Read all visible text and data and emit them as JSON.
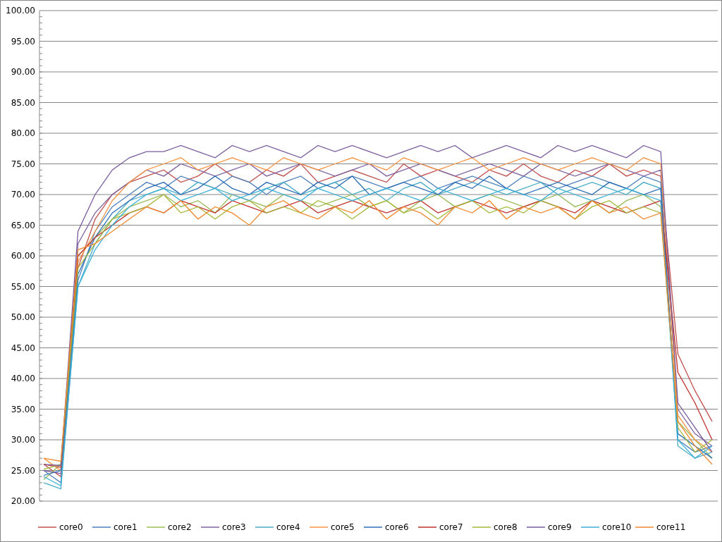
{
  "chart_data": {
    "type": "line",
    "ylim": [
      20,
      100
    ],
    "grid": true,
    "legend": true,
    "yticks": [
      {
        "value": 20,
        "label": "20.00"
      },
      {
        "value": 25,
        "label": "25.00"
      },
      {
        "value": 30,
        "label": "30.00"
      },
      {
        "value": 35,
        "label": "35.00"
      },
      {
        "value": 40,
        "label": "40.00"
      },
      {
        "value": 45,
        "label": "45.00"
      },
      {
        "value": 50,
        "label": "50.00"
      },
      {
        "value": 55,
        "label": "55.00"
      },
      {
        "value": 60,
        "label": "60.00"
      },
      {
        "value": 65,
        "label": "65.00"
      },
      {
        "value": 70,
        "label": "70.00"
      },
      {
        "value": 75,
        "label": "75.00"
      },
      {
        "value": 80,
        "label": "80.00"
      },
      {
        "value": 85,
        "label": "85.00"
      },
      {
        "value": 90,
        "label": "90.00"
      },
      {
        "value": 95,
        "label": "95.00"
      },
      {
        "value": 100,
        "label": "100.00"
      }
    ],
    "series": [
      {
        "name": "core0",
        "color": "#c0504d",
        "values": [
          26,
          24,
          58,
          66,
          70,
          72,
          73,
          74,
          72,
          73,
          75,
          73,
          72,
          74,
          73,
          75,
          72,
          73,
          74,
          73,
          72,
          75,
          73,
          74,
          73,
          72,
          74,
          73,
          75,
          73,
          72,
          74,
          73,
          75,
          73,
          74,
          73,
          44,
          38,
          33
        ]
      },
      {
        "name": "core1",
        "color": "#4f81bd",
        "values": [
          25,
          23,
          56,
          64,
          68,
          70,
          72,
          71,
          73,
          72,
          71,
          73,
          72,
          70,
          72,
          73,
          71,
          72,
          73,
          72,
          71,
          72,
          73,
          71,
          72,
          73,
          72,
          71,
          73,
          72,
          71,
          72,
          73,
          72,
          71,
          73,
          72,
          30,
          28,
          29
        ]
      },
      {
        "name": "core2",
        "color": "#9bbb59",
        "values": [
          23.5,
          26,
          60,
          63,
          66,
          68,
          69,
          70,
          68,
          69,
          67,
          70,
          69,
          68,
          70,
          69,
          68,
          69,
          70,
          68,
          69,
          67,
          69,
          70,
          68,
          69,
          70,
          69,
          68,
          69,
          70,
          68,
          69,
          67,
          69,
          70,
          68,
          33,
          30,
          27
        ]
      },
      {
        "name": "core3",
        "color": "#8064a2",
        "values": [
          25,
          24.5,
          62,
          67,
          70,
          72,
          74,
          73,
          75,
          74,
          73,
          74,
          75,
          73,
          74,
          75,
          74,
          73,
          74,
          75,
          73,
          74,
          75,
          74,
          73,
          74,
          75,
          74,
          73,
          75,
          74,
          73,
          74,
          75,
          74,
          73,
          74,
          35,
          31,
          29
        ]
      },
      {
        "name": "core4",
        "color": "#4bacc6",
        "values": [
          23,
          22,
          55,
          62,
          66,
          69,
          70,
          71,
          70,
          72,
          71,
          70,
          69,
          71,
          72,
          70,
          71,
          72,
          70,
          71,
          69,
          71,
          72,
          70,
          71,
          72,
          71,
          70,
          71,
          72,
          70,
          71,
          72,
          71,
          70,
          72,
          71,
          29,
          27,
          28
        ]
      },
      {
        "name": "core5",
        "color": "#f79646",
        "values": [
          27,
          25,
          59,
          64,
          69,
          72,
          74,
          75,
          76,
          74,
          75,
          76,
          75,
          74,
          76,
          75,
          74,
          75,
          76,
          75,
          74,
          76,
          75,
          74,
          75,
          76,
          74,
          75,
          76,
          75,
          74,
          75,
          76,
          75,
          74,
          76,
          75,
          34,
          30,
          28
        ]
      },
      {
        "name": "core6",
        "color": "#2c6fb5",
        "values": [
          24.2,
          25,
          57,
          63,
          67,
          69,
          71,
          72,
          70,
          71,
          73,
          71,
          70,
          72,
          71,
          70,
          72,
          71,
          73,
          70,
          71,
          72,
          71,
          70,
          72,
          71,
          73,
          71,
          70,
          71,
          72,
          71,
          70,
          72,
          71,
          70,
          71,
          31,
          29,
          27
        ]
      },
      {
        "name": "core7",
        "color": "#c0302c",
        "values": [
          26,
          25.5,
          60,
          63,
          65,
          67,
          68,
          67,
          69,
          68,
          67,
          69,
          68,
          67,
          68,
          69,
          67,
          68,
          69,
          68,
          67,
          68,
          69,
          67,
          68,
          69,
          68,
          67,
          68,
          69,
          68,
          67,
          69,
          68,
          67,
          68,
          69,
          41,
          36,
          30
        ]
      },
      {
        "name": "core8",
        "color": "#a5b83a",
        "values": [
          25.2,
          26,
          58,
          62,
          66,
          67,
          68,
          70,
          67,
          68,
          66,
          68,
          69,
          67,
          68,
          67,
          69,
          68,
          66,
          68,
          69,
          67,
          68,
          66,
          68,
          69,
          67,
          68,
          67,
          69,
          68,
          66,
          68,
          69,
          67,
          68,
          67,
          32,
          28,
          30
        ]
      },
      {
        "name": "core9",
        "color": "#7a5c9e",
        "values": [
          26,
          25.8,
          64,
          70,
          74,
          76,
          77,
          77,
          78,
          77,
          76,
          78,
          77,
          78,
          77,
          76,
          78,
          77,
          78,
          77,
          76,
          77,
          78,
          77,
          78,
          76,
          77,
          78,
          77,
          76,
          78,
          77,
          78,
          77,
          76,
          78,
          77,
          36,
          32,
          28
        ]
      },
      {
        "name": "core10",
        "color": "#38b0d8",
        "values": [
          24,
          22.5,
          55,
          61,
          65,
          68,
          70,
          71,
          69,
          70,
          71,
          69,
          70,
          71,
          70,
          69,
          71,
          70,
          69,
          70,
          71,
          70,
          69,
          71,
          70,
          69,
          70,
          71,
          70,
          69,
          71,
          70,
          69,
          70,
          71,
          70,
          69,
          30,
          27,
          29
        ]
      },
      {
        "name": "core11",
        "color": "#f08a30",
        "values": [
          27,
          26.5,
          61,
          62,
          64,
          66,
          68,
          67,
          69,
          66,
          68,
          67,
          65,
          68,
          69,
          67,
          66,
          68,
          67,
          69,
          66,
          68,
          67,
          65,
          68,
          67,
          69,
          66,
          68,
          67,
          68,
          66,
          69,
          67,
          68,
          66,
          67,
          33,
          29,
          26
        ]
      }
    ]
  }
}
